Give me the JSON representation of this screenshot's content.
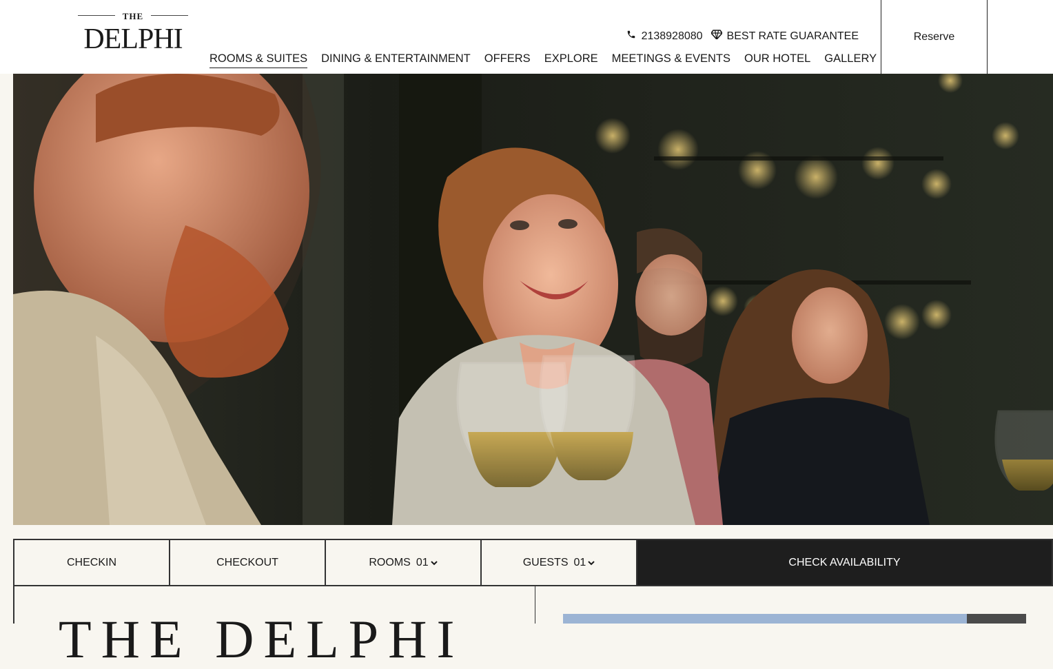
{
  "header": {
    "logo": {
      "small": "THE",
      "main": "DELPHI"
    },
    "phone": "2138928080",
    "rate_guarantee": "BEST RATE GUARANTEE",
    "reserve_label": "Reserve",
    "icons": {
      "phone": "phone-icon",
      "diamond": "diamond-icon"
    }
  },
  "nav": {
    "items": [
      {
        "label": "ROOMS & SUITES",
        "active": true
      },
      {
        "label": "DINING & ENTERTAINMENT",
        "active": false
      },
      {
        "label": "OFFERS",
        "active": false
      },
      {
        "label": "EXPLORE",
        "active": false
      },
      {
        "label": "MEETINGS & EVENTS",
        "active": false
      },
      {
        "label": "OUR HOTEL",
        "active": false
      },
      {
        "label": "GALLERY",
        "active": false
      }
    ]
  },
  "booking": {
    "checkin_label": "CHECKIN",
    "checkout_label": "CHECKOUT",
    "rooms_label": "ROOMS",
    "rooms_value": "01",
    "guests_label": "GUESTS",
    "guests_value": "01",
    "cta_label": "CHECK AVAILABILITY"
  },
  "content": {
    "title": "THE DELPHI"
  },
  "colors": {
    "cta_background": "#1e1e1e",
    "page_background": "#f8f6f0"
  }
}
